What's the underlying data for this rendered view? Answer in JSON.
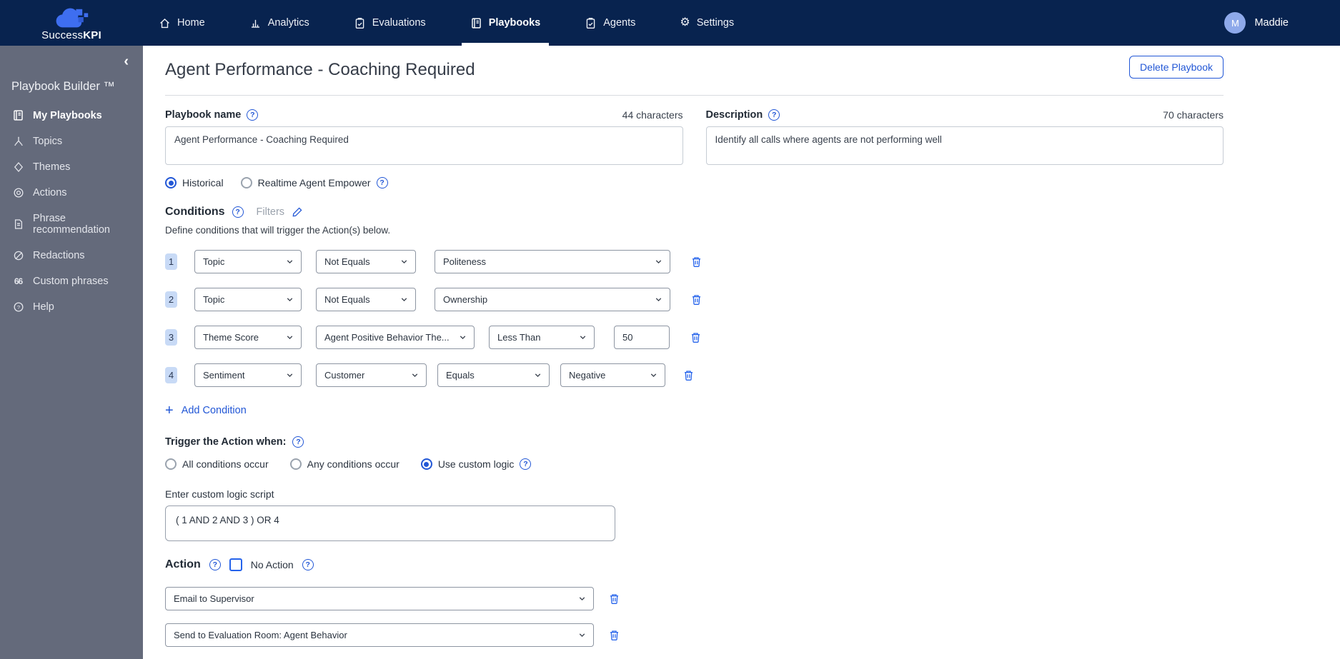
{
  "colors": {
    "navbar_bg": "#08234f",
    "sidebar_bg": "#646a7b",
    "accent_blue": "#2257d6",
    "icon_blue": "#2563eb",
    "logo_blue": "#3e6ef0",
    "avatar_bg": "#8ea9ea",
    "badge_bg": "#c8daf6"
  },
  "icons": {
    "help": "?",
    "chevron_left": "‹",
    "plus": "+",
    "gear": "⚙",
    "custom_phrases": "66"
  },
  "navbar": {
    "brand": {
      "name_regular": "Success",
      "name_bold": "KPI"
    },
    "items": [
      {
        "label": "Home",
        "icon": "home-icon",
        "active": false
      },
      {
        "label": "Analytics",
        "icon": "analytics-icon",
        "active": false
      },
      {
        "label": "Evaluations",
        "icon": "evaluations-icon",
        "active": false
      },
      {
        "label": "Playbooks",
        "icon": "playbooks-icon",
        "active": true
      },
      {
        "label": "Agents",
        "icon": "agents-icon",
        "active": false
      },
      {
        "label": "Settings",
        "icon": "gear-icon",
        "active": false
      }
    ],
    "user": {
      "initial": "M",
      "name": "Maddie"
    }
  },
  "sidebar": {
    "title": "Playbook Builder ™",
    "items": [
      {
        "label": "My Playbooks",
        "icon": "book-icon",
        "active": true
      },
      {
        "label": "Topics",
        "icon": "topics-icon",
        "active": false
      },
      {
        "label": "Themes",
        "icon": "diamond-icon",
        "active": false
      },
      {
        "label": "Actions",
        "icon": "target-icon",
        "active": false
      },
      {
        "label": "Phrase recommendation",
        "icon": "document-icon",
        "active": false
      },
      {
        "label": "Redactions",
        "icon": "redaction-icon",
        "active": false
      },
      {
        "label": "Custom phrases",
        "icon": "quotes-icon",
        "active": false
      },
      {
        "label": "Help",
        "icon": "help-circle-icon",
        "active": false
      }
    ]
  },
  "page": {
    "title": "Agent Performance - Coaching Required",
    "delete_button": "Delete Playbook"
  },
  "form": {
    "playbook_name": {
      "label": "Playbook name",
      "counter": "44 characters",
      "value": "Agent Performance - Coaching Required"
    },
    "description": {
      "label": "Description",
      "counter": "70 characters",
      "value": "Identify all calls where agents are not performing well"
    },
    "mode_options": [
      {
        "label": "Historical",
        "selected": true
      },
      {
        "label": "Realtime Agent Empower",
        "selected": false
      }
    ]
  },
  "conditions": {
    "heading": "Conditions",
    "filters_label": "Filters",
    "subtitle": "Define conditions that will trigger the Action(s) below.",
    "rows": [
      {
        "index": "1",
        "fields": [
          "Topic",
          "Not Equals",
          "Politeness"
        ]
      },
      {
        "index": "2",
        "fields": [
          "Topic",
          "Not Equals",
          "Ownership"
        ]
      },
      {
        "index": "3",
        "fields": [
          "Theme Score",
          "Agent Positive Behavior The...",
          "Less Than",
          "50"
        ]
      },
      {
        "index": "4",
        "fields": [
          "Sentiment",
          "Customer",
          "Equals",
          "Negative"
        ]
      }
    ],
    "add_condition_label": "Add Condition"
  },
  "trigger": {
    "label": "Trigger the Action when:",
    "options": [
      {
        "label": "All conditions occur",
        "selected": false
      },
      {
        "label": "Any conditions occur",
        "selected": false
      },
      {
        "label": "Use custom logic",
        "selected": true
      }
    ],
    "script_label": "Enter custom logic script",
    "script_value": "( 1 AND 2 AND 3 ) OR 4"
  },
  "action": {
    "heading": "Action",
    "no_action_label": "No Action",
    "items": [
      "Email to Supervisor",
      "Send to Evaluation Room: Agent Behavior"
    ]
  }
}
